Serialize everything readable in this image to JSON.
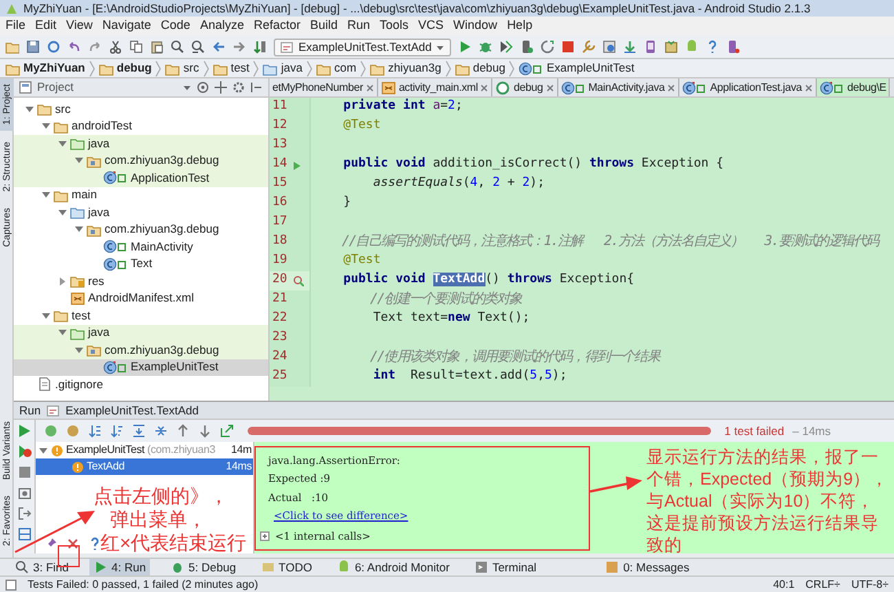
{
  "window": {
    "title": "MyZhiYuan - [E:\\AndroidStudioProjects\\MyZhiYuan] - [debug] - ...\\debug\\src\\test\\java\\com\\zhiyuan3g\\debug\\ExampleUnitTest.java - Android Studio 2.1.3"
  },
  "menu": [
    "File",
    "Edit",
    "View",
    "Navigate",
    "Code",
    "Analyze",
    "Refactor",
    "Build",
    "Run",
    "Tools",
    "VCS",
    "Window",
    "Help"
  ],
  "toolbar": {
    "run_config": "ExampleUnitTest.TextAdd"
  },
  "breadcrumbs": [
    {
      "label": "MyZhiYuan",
      "kind": "project"
    },
    {
      "label": "debug",
      "kind": "module"
    },
    {
      "label": "src",
      "kind": "folder"
    },
    {
      "label": "test",
      "kind": "folder"
    },
    {
      "label": "java",
      "kind": "source"
    },
    {
      "label": "com",
      "kind": "folder"
    },
    {
      "label": "zhiyuan3g",
      "kind": "folder"
    },
    {
      "label": "debug",
      "kind": "folder"
    },
    {
      "label": "ExampleUnitTest",
      "kind": "class"
    }
  ],
  "side_tabs_top": [
    {
      "label": "1: Project",
      "selected": true
    },
    {
      "label": "2: Structure",
      "selected": false
    },
    {
      "label": "Captures",
      "selected": false
    }
  ],
  "side_tabs_bottom": [
    {
      "label": "Build Variants",
      "selected": false
    },
    {
      "label": "2: Favorites",
      "selected": false
    }
  ],
  "project_panel": {
    "title": "Project",
    "tree": [
      {
        "label": "src",
        "kind": "folder",
        "expanded": true,
        "selected": false,
        "children": [
          {
            "label": "androidTest",
            "kind": "folder",
            "expanded": true,
            "selected": false,
            "children": [
              {
                "label": "java",
                "kind": "test-source",
                "expanded": true,
                "selected": false,
                "children": [
                  {
                    "label": "com.zhiyuan3g.debug",
                    "kind": "package",
                    "expanded": true,
                    "selected": false,
                    "children": [
                      {
                        "label": "ApplicationTest",
                        "kind": "test-class",
                        "selected": false
                      }
                    ]
                  }
                ]
              }
            ]
          },
          {
            "label": "main",
            "kind": "folder",
            "expanded": true,
            "selected": false,
            "children": [
              {
                "label": "java",
                "kind": "source",
                "expanded": true,
                "selected": false,
                "children": [
                  {
                    "label": "com.zhiyuan3g.debug",
                    "kind": "package",
                    "expanded": true,
                    "selected": false,
                    "children": [
                      {
                        "label": "MainActivity",
                        "kind": "class",
                        "selected": false
                      },
                      {
                        "label": "Text",
                        "kind": "class",
                        "selected": false
                      }
                    ]
                  }
                ]
              },
              {
                "label": "res",
                "kind": "resource",
                "expanded": false,
                "selected": false
              },
              {
                "label": "AndroidManifest.xml",
                "kind": "xml",
                "selected": false
              }
            ]
          },
          {
            "label": "test",
            "kind": "folder",
            "expanded": true,
            "selected": false,
            "children": [
              {
                "label": "java",
                "kind": "test-source",
                "expanded": true,
                "selected": false,
                "children": [
                  {
                    "label": "com.zhiyuan3g.debug",
                    "kind": "package",
                    "expanded": true,
                    "selected": false,
                    "children": [
                      {
                        "label": "ExampleUnitTest",
                        "kind": "test-class",
                        "selected": true
                      }
                    ]
                  }
                ]
              }
            ]
          }
        ]
      },
      {
        "label": ".gitignore",
        "kind": "file",
        "selected": false
      }
    ]
  },
  "editor_tabs": [
    {
      "label": "etMyPhoneNumber",
      "selected": false
    },
    {
      "label": "activity_main.xml",
      "kind": "xml",
      "selected": false
    },
    {
      "label": "debug",
      "kind": "gradle",
      "selected": false
    },
    {
      "label": "MainActivity.java",
      "kind": "class",
      "selected": false
    },
    {
      "label": "ApplicationTest.java",
      "kind": "test-class",
      "selected": false
    },
    {
      "label": "debug\\E",
      "kind": "test-class",
      "selected": true
    }
  ],
  "code_lines": [
    {
      "number": "11",
      "run_marker": false,
      "failed_marker": false,
      "tokens": [
        {
          "kind": "keyword",
          "text": "    private int"
        },
        {
          "kind": "field",
          "text": " a"
        },
        {
          "kind": "plain",
          "text": "="
        },
        {
          "kind": "number",
          "text": "2"
        },
        {
          "kind": "plain",
          "text": ";"
        }
      ]
    },
    {
      "number": "12",
      "run_marker": false,
      "failed_marker": false,
      "tokens": [
        {
          "kind": "annotation",
          "text": "    @Test"
        }
      ]
    },
    {
      "number": "13",
      "run_marker": false,
      "failed_marker": false
    },
    {
      "number": "14",
      "run_marker": true,
      "failed_marker": false,
      "tokens": [
        {
          "kind": "keyword",
          "text": "    public void"
        },
        {
          "kind": "plain",
          "text": " addition_isCorrect() "
        },
        {
          "kind": "keyword",
          "text": "throws"
        },
        {
          "kind": "plain",
          "text": " Exception {"
        }
      ]
    },
    {
      "number": "15",
      "run_marker": false,
      "failed_marker": false,
      "tokens": [
        {
          "kind": "static",
          "text": "        assertEquals"
        },
        {
          "kind": "plain",
          "text": "("
        },
        {
          "kind": "number",
          "text": "4"
        },
        {
          "kind": "plain",
          "text": ", "
        },
        {
          "kind": "number",
          "text": "2"
        },
        {
          "kind": "plain",
          "text": " + "
        },
        {
          "kind": "number",
          "text": "2"
        },
        {
          "kind": "plain",
          "text": ");"
        }
      ]
    },
    {
      "number": "16",
      "run_marker": false,
      "failed_marker": false,
      "tokens": [
        {
          "kind": "plain",
          "text": "    }"
        }
      ]
    },
    {
      "number": "17",
      "run_marker": false,
      "failed_marker": false
    },
    {
      "number": "18",
      "run_marker": false,
      "failed_marker": false,
      "tokens": [
        {
          "kind": "comment",
          "text": "    //自己编写的测试代码，注意格式：1.注解   2.方法（方法名自定义）   3.要测试的逻辑代码"
        }
      ]
    },
    {
      "number": "19",
      "run_marker": false,
      "failed_marker": false,
      "tokens": [
        {
          "kind": "annotation",
          "text": "    @Test"
        }
      ]
    },
    {
      "number": "20",
      "run_marker": false,
      "failed_marker": true,
      "tokens": [
        {
          "kind": "keyword",
          "text": "    public void"
        },
        {
          "kind": "selection",
          "text": "TextAdd"
        },
        {
          "kind": "plain",
          "text": "() "
        },
        {
          "kind": "keyword",
          "text": "throws"
        },
        {
          "kind": "plain",
          "text": " Exception{"
        }
      ]
    },
    {
      "number": "21",
      "run_marker": false,
      "failed_marker": false,
      "tokens": [
        {
          "kind": "comment",
          "text": "        //创建一个要测试的类对象"
        }
      ]
    },
    {
      "number": "22",
      "run_marker": false,
      "failed_marker": false,
      "tokens": [
        {
          "kind": "plain",
          "text": "        Text text="
        },
        {
          "kind": "keyword",
          "text": "new"
        },
        {
          "kind": "plain",
          "text": " Text();"
        }
      ]
    },
    {
      "number": "23",
      "run_marker": false,
      "failed_marker": false
    },
    {
      "number": "24",
      "run_marker": false,
      "failed_marker": false,
      "tokens": [
        {
          "kind": "comment",
          "text": "        //使用该类对象，调用要测试的代码，得到一个结果"
        }
      ]
    },
    {
      "number": "25",
      "run_marker": false,
      "failed_marker": false,
      "tokens": [
        {
          "kind": "keyword",
          "text": "        int"
        },
        {
          "kind": "plain",
          "text": "  Result=text.add("
        },
        {
          "kind": "number",
          "text": "5"
        },
        {
          "kind": "plain",
          "text": ","
        },
        {
          "kind": "number",
          "text": "5"
        },
        {
          "kind": "plain",
          "text": ");"
        }
      ]
    }
  ],
  "run_panel": {
    "title": "Run",
    "config": "ExampleUnitTest.TextAdd",
    "progress": {
      "level": 1,
      "failed": true
    },
    "status": "1 test failed",
    "duration": "– 14ms",
    "tests": [
      {
        "label": "ExampleUnitTest",
        "detail": "(com.zhiyuan3",
        "time": "14m",
        "expanded": true,
        "selected": false,
        "children": [
          {
            "label": "TextAdd",
            "time": "14ms",
            "selected": true
          }
        ]
      }
    ],
    "output": [
      {
        "kind": "text",
        "text": "java.lang.AssertionError:"
      },
      {
        "kind": "text",
        "text": "Expected :9"
      },
      {
        "kind": "text",
        "text": "Actual   :10"
      },
      {
        "kind": "link",
        "text": "<Click to see difference>"
      },
      {
        "kind": "fold",
        "text": "<1 internal calls>"
      }
    ]
  },
  "tool_tabs": [
    {
      "label": "3: Find",
      "kind": "find",
      "selected": false
    },
    {
      "label": "4: Run",
      "kind": "run",
      "selected": true
    },
    {
      "label": "5: Debug",
      "kind": "debug",
      "selected": false
    },
    {
      "label": "TODO",
      "kind": "todo",
      "selected": false
    },
    {
      "label": "6: Android Monitor",
      "kind": "android",
      "selected": false
    },
    {
      "label": "Terminal",
      "kind": "terminal",
      "selected": false
    },
    {
      "label": "0: Messages",
      "kind": "messages",
      "selected": false
    }
  ],
  "status_bar": {
    "message": "Tests Failed: 0 passed, 1 failed (2 minutes ago)",
    "items": [
      "40:1",
      "CRLF÷",
      "UTF-8÷"
    ]
  },
  "annotations": {
    "left_note": [
      "点击左侧的》，",
      "弹出菜单，",
      "红×代表结束运行"
    ],
    "right_note": "显示运行方法的结果，报了一个错，Expected（预期为9），与Actual（实际为10）不符，这是提前预设方法运行结果导致的"
  }
}
